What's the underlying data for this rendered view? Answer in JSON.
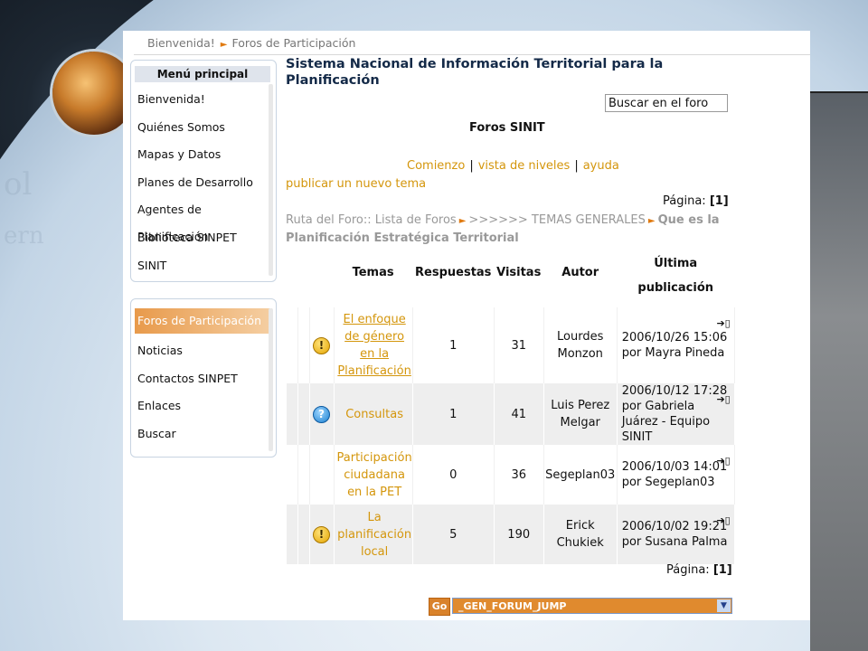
{
  "breadcrumb": {
    "home": "Bienvenida!",
    "current": "Foros de Participación"
  },
  "site_title": "Sistema Nacional de Información Territorial para la Planificación",
  "main_menu": {
    "title": "Menú principal",
    "items": [
      "Bienvenida!",
      "Quiénes Somos",
      "Mapas y Datos",
      "Planes de Desarrollo",
      "Agentes de Planificación",
      "Biblioteca SINPET",
      "SINIT"
    ]
  },
  "secondary_menu": {
    "active": "Foros de Participación",
    "items": [
      "Noticias",
      "Contactos SINPET",
      "Enlaces",
      "Buscar"
    ]
  },
  "search": {
    "value": "Buscar en el foro"
  },
  "forum_heading": "Foros SINIT",
  "nav_links": {
    "start": "Comienzo",
    "levels": "vista de niveles",
    "help": "ayuda",
    "new_topic": "publicar un nuevo tema"
  },
  "page_info": {
    "label": "Página:",
    "value": "[1]"
  },
  "forum_path": {
    "prefix": "Ruta del Foro:: Lista de Foros",
    "mid": ">>>>>> TEMAS GENERALES",
    "current": "Que es la Planificación Estratégica Territorial"
  },
  "table": {
    "headers": {
      "topics": "Temas",
      "replies": "Respuestas",
      "visits": "Visitas",
      "author": "Autor",
      "last_post_1": "Última",
      "last_post_2": "publicación"
    },
    "rows": [
      {
        "icon": "warning-icon",
        "topic": "El enfoque de género en la Planificación",
        "replies": "1",
        "visits": "31",
        "author": "Lourdes Monzon",
        "date": "2006/10/26 15:06",
        "by": "por Mayra Pineda"
      },
      {
        "icon": "help-icon",
        "topic": "Consultas",
        "replies": "1",
        "visits": "41",
        "author": "Luis Perez Melgar",
        "date": "2006/10/12 17:28",
        "by": "por Gabriela Juárez - Equipo SINIT"
      },
      {
        "icon": "",
        "topic": "Participación ciudadana en la PET",
        "replies": "0",
        "visits": "36",
        "author": "Segeplan03",
        "date": "2006/10/03 14:01",
        "by": "por Segeplan03"
      },
      {
        "icon": "warning-icon",
        "topic": "La planificación local",
        "replies": "5",
        "visits": "190",
        "author": "Erick Chukiek",
        "date": "2006/10/02 19:21",
        "by": "por Susana Palma"
      }
    ]
  },
  "jump": {
    "go_label": "Go",
    "selected": "_GEN_FORUM_JUMP"
  },
  "colors": {
    "link": "#d4960c",
    "title": "#142a48",
    "active_menu": "#e89a4b"
  }
}
